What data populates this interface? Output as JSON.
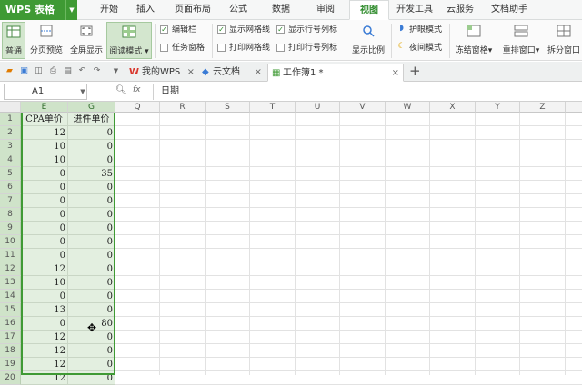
{
  "app": {
    "name": "WPS 表格"
  },
  "menu": [
    "开始",
    "插入",
    "页面布局",
    "公式",
    "数据",
    "审阅",
    "视图",
    "开发工具",
    "云服务",
    "文档助手"
  ],
  "active_menu": "视图",
  "ribbon": {
    "normal": "普通",
    "page_break": "分页预览",
    "full_screen": "全屏显示",
    "reading_mode": "阅读模式",
    "edit_bar": "编辑栏",
    "task_pane": "任务窗格",
    "show_gridlines": "显示网格线",
    "print_gridlines": "打印网格线",
    "show_headers": "显示行号列标",
    "print_headers": "打印行号列标",
    "zoom": "显示比例",
    "eye_protect": "护眼模式",
    "night_mode": "夜间模式",
    "freeze": "冻结窗格",
    "arrange": "重排窗口",
    "split": "拆分窗口"
  },
  "tabs": [
    {
      "label": "我的WPS"
    },
    {
      "label": "云文档"
    },
    {
      "label": "工作簿1 *"
    }
  ],
  "formula_bar": {
    "cell_ref": "A1",
    "fx": "fx",
    "content": "日期"
  },
  "columns": [
    "E",
    "G",
    "Q",
    "R",
    "S",
    "T",
    "U",
    "V",
    "W",
    "X",
    "Y",
    "Z"
  ],
  "rows": [
    {
      "n": "1",
      "e": "CPA单价",
      "g": "进件单价"
    },
    {
      "n": "2",
      "e": "12",
      "g": "0"
    },
    {
      "n": "3",
      "e": "10",
      "g": "0"
    },
    {
      "n": "4",
      "e": "10",
      "g": "0"
    },
    {
      "n": "5",
      "e": "0",
      "g": "35"
    },
    {
      "n": "6",
      "e": "0",
      "g": "0"
    },
    {
      "n": "7",
      "e": "0",
      "g": "0"
    },
    {
      "n": "8",
      "e": "0",
      "g": "0"
    },
    {
      "n": "9",
      "e": "0",
      "g": "0"
    },
    {
      "n": "10",
      "e": "0",
      "g": "0"
    },
    {
      "n": "11",
      "e": "0",
      "g": "0"
    },
    {
      "n": "12",
      "e": "12",
      "g": "0"
    },
    {
      "n": "13",
      "e": "10",
      "g": "0"
    },
    {
      "n": "14",
      "e": "0",
      "g": "0"
    },
    {
      "n": "15",
      "e": "13",
      "g": "0"
    },
    {
      "n": "16",
      "e": "0",
      "g": "80"
    },
    {
      "n": "17",
      "e": "12",
      "g": "0"
    },
    {
      "n": "18",
      "e": "12",
      "g": "0"
    },
    {
      "n": "19",
      "e": "12",
      "g": "0"
    },
    {
      "n": "20",
      "e": "12",
      "g": "0"
    }
  ],
  "colors": {
    "brand": "#3f9a34",
    "selection": "#e3efe0",
    "active_tab": "#2e8b2b"
  }
}
